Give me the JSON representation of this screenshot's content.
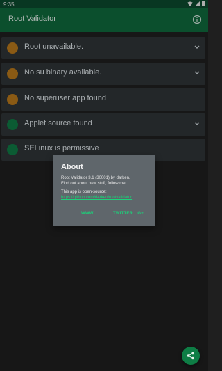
{
  "status_bar": {
    "time": "9:35"
  },
  "app_bar": {
    "title": "Root Validator"
  },
  "items": [
    {
      "label": "Root unavailable.",
      "state_color": "#b9781b",
      "expandable": true
    },
    {
      "label": "No su binary available.",
      "state_color": "#b9781b",
      "expandable": true
    },
    {
      "label": "No superuser app found",
      "state_color": "#b9781b",
      "expandable": false
    },
    {
      "label": "Applet source found",
      "state_color": "#0f7a45",
      "expandable": true
    },
    {
      "label": "SELinux is permissive",
      "state_color": "#0f7a45",
      "expandable": false
    }
  ],
  "dialog": {
    "title": "About",
    "body_line1": "Root Validator 3.1 (30001) by darken.",
    "body_line2": "Find out about new stuff, follow me.",
    "body_line3": "This app is open-source:",
    "link": "https://github.com/d4rken/rootvalidator",
    "actions": {
      "www": "WWW",
      "twitter": "TWITTER",
      "gplus": "G+"
    }
  },
  "icons": {
    "info": "info-icon",
    "share": "share-icon",
    "chevron": "chevron-down-icon"
  },
  "colors": {
    "app_bar": "#0f6a3d",
    "status_bar": "#0b4a2e",
    "accent": "#1bd27a",
    "warning": "#b9781b",
    "ok": "#0f7a45"
  }
}
